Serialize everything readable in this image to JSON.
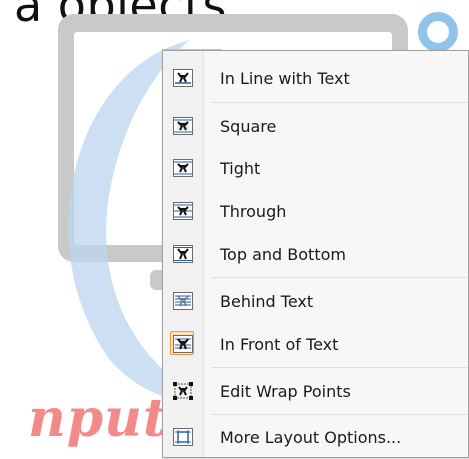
{
  "background": {
    "caption_text": "a objects.",
    "watermark_text": "nput"
  },
  "colors": {
    "menu_background": "#f7f7f7",
    "menu_border": "#a0a0a0",
    "checked_fill": "#fde3b4",
    "checked_border": "#e29a3b",
    "icon_accent": "#2b5ea8"
  },
  "context_menu": {
    "items": [
      {
        "label": "In Line with Text",
        "icon": "inline-with-text-icon",
        "checked": false
      },
      {
        "label": "Square",
        "icon": "wrap-square-icon",
        "checked": false
      },
      {
        "label": "Tight",
        "icon": "wrap-tight-icon",
        "checked": false
      },
      {
        "label": "Through",
        "icon": "wrap-through-icon",
        "checked": false
      },
      {
        "label": "Top and Bottom",
        "icon": "wrap-top-bottom-icon",
        "checked": false
      },
      {
        "label": "Behind Text",
        "icon": "behind-text-icon",
        "checked": false
      },
      {
        "label": "In Front of Text",
        "icon": "in-front-of-text-icon",
        "checked": true
      },
      {
        "label": "Edit Wrap Points",
        "icon": "edit-wrap-points-icon",
        "checked": false
      },
      {
        "label": "More Layout Options...",
        "icon": "more-layout-options-icon",
        "checked": false
      }
    ]
  }
}
